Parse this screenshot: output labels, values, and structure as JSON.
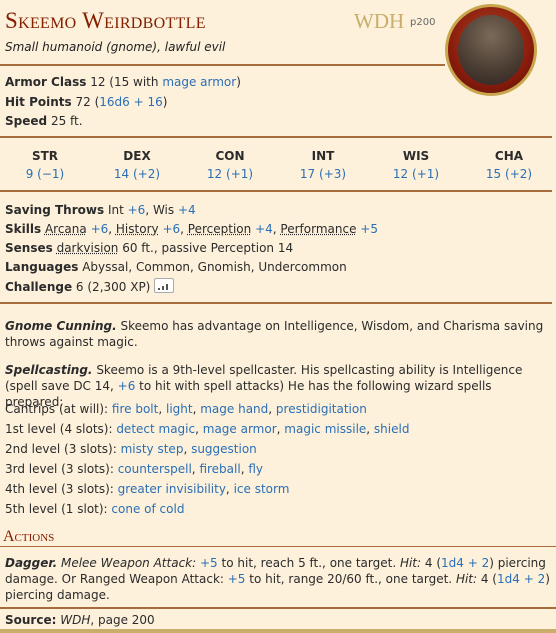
{
  "name": "Skeemo Weirdbottle",
  "source_abbr": "WDH",
  "source_page": "p200",
  "type_line": "Small humanoid (gnome), lawful evil",
  "armor_class": {
    "label": "Armor Class",
    "value": "12 (15 with ",
    "link": "mage armor",
    "end": ")"
  },
  "hit_points": {
    "label": "Hit Points",
    "value": "72 (",
    "link": "16d6 + 16",
    "end": ")"
  },
  "speed": {
    "label": "Speed",
    "value": "25 ft."
  },
  "abilities": [
    {
      "name": "STR",
      "value": "9 (−1)"
    },
    {
      "name": "DEX",
      "value": "14 (+2)"
    },
    {
      "name": "CON",
      "value": "12 (+1)"
    },
    {
      "name": "INT",
      "value": "17 (+3)"
    },
    {
      "name": "WIS",
      "value": "12 (+1)"
    },
    {
      "name": "CHA",
      "value": "15 (+2)"
    }
  ],
  "saving_throws": {
    "label": "Saving Throws",
    "int": "Int ",
    "int_mod": "+6",
    "wis": ", Wis ",
    "wis_mod": "+4"
  },
  "skills": {
    "label": "Skills",
    "items": [
      {
        "name": "Arcana",
        "mod": "+6"
      },
      {
        "name": "History",
        "mod": "+6"
      },
      {
        "name": "Perception",
        "mod": "+4"
      },
      {
        "name": "Performance",
        "mod": "+5"
      }
    ]
  },
  "senses": {
    "label": "Senses",
    "dark": "darkvision",
    "rest": " 60 ft., passive Perception 14"
  },
  "languages": {
    "label": "Languages",
    "value": "Abyssal, Common, Gnomish, Undercommon"
  },
  "challenge": {
    "label": "Challenge",
    "value": "6 (2,300 XP)"
  },
  "gnome_cunning": {
    "title": "Gnome Cunning.",
    "text1": " Skeemo has advantage on Intelligence, Wisdom, and Charisma saving",
    "text2": "throws against magic."
  },
  "spellcasting": {
    "title": "Spellcasting.",
    "text1": " Skeemo is a 9th-level spellcaster. His spellcasting ability is Intelligence",
    "text2a": "(spell save DC 14, ",
    "text2b": "+6",
    "text2c": " to hit with spell attacks) He has the following wizard spells prepared:"
  },
  "spell_levels": [
    {
      "label": "Cantrips (at will): ",
      "spells": [
        "fire bolt",
        "light",
        "mage hand",
        "prestidigitation"
      ]
    },
    {
      "label": "1st level (4 slots): ",
      "spells": [
        "detect magic",
        "mage armor",
        "magic missile",
        "shield"
      ]
    },
    {
      "label": "2nd level (3 slots): ",
      "spells": [
        "misty step",
        "suggestion"
      ]
    },
    {
      "label": "3rd level (3 slots): ",
      "spells": [
        "counterspell",
        "fireball",
        "fly"
      ]
    },
    {
      "label": "4th level (3 slots): ",
      "spells": [
        "greater invisibility",
        "ice storm"
      ]
    },
    {
      "label": "5th level (1 slot): ",
      "spells": [
        "cone of cold"
      ]
    }
  ],
  "actions_heading": "Actions",
  "dagger": {
    "title": "Dagger.",
    "melee": " Melee Weapon Attack:",
    "hit1": "+5",
    "t1": " to hit, reach 5 ft., one target. ",
    "hitlbl": "Hit:",
    "t2": " 4 (",
    "dmg": "1d4 + 2",
    "t3": ") piercing",
    "l2a": "damage. Or Ranged Weapon Attack: ",
    "hit2": "+5",
    "l2b": " to hit, range 20/60 ft., one target. ",
    "hitlbl2": "Hit:",
    "l2c": " 4 (",
    "dmg2": "1d4 + 2",
    "l2d": ")",
    "l3": "piercing damage."
  },
  "source": {
    "label": "Source:",
    "book": "WDH",
    "rest": ", page 200"
  }
}
